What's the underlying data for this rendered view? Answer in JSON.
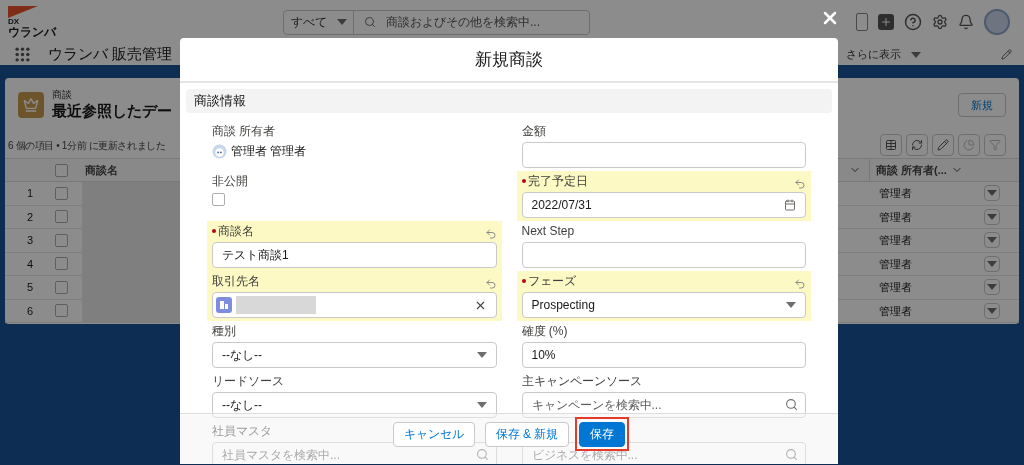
{
  "logo": {
    "line_1": "DX",
    "line_2": "ウランバ"
  },
  "header": {
    "scope": "すべて",
    "search_placeholder": "商談およびその他を検索中..."
  },
  "app_name": "ウランバ 販売管理",
  "nav": {
    "more_tab": "さらに表示"
  },
  "list": {
    "object": "商談",
    "title": "最近参照したデー",
    "all_selected": false,
    "status": "6 個の項目 • 1分前 に更新されました",
    "new_button": "新規",
    "columns": [
      {
        "label": "商談名"
      },
      {
        "label": "商談 所有者(..."
      }
    ],
    "rows": [
      {
        "number": "1",
        "owner": "管理者",
        "checked": false
      },
      {
        "number": "2",
        "owner": "管理者",
        "checked": false
      },
      {
        "number": "3",
        "owner": "管理者",
        "checked": false
      },
      {
        "number": "4",
        "owner": "管理者",
        "checked": false
      },
      {
        "number": "5",
        "owner": "管理者",
        "checked": false
      },
      {
        "number": "6",
        "owner": "管理者",
        "checked": false
      }
    ]
  },
  "modal": {
    "title": "新規商談",
    "section": "商談情報",
    "left_fields": [
      {
        "kind": "owner",
        "label": "商談 所有者",
        "value": "管理者 管理者",
        "required": false,
        "changed": false
      },
      {
        "kind": "checkbox",
        "label": "非公開",
        "checked": false,
        "required": false,
        "changed": false
      },
      {
        "kind": "text",
        "label": "商談名",
        "value": "テスト商談1",
        "required": true,
        "changed": true
      },
      {
        "kind": "record",
        "label": "取引先名",
        "required": false,
        "changed": true
      },
      {
        "kind": "select",
        "label": "種別",
        "value": "--なし--",
        "required": false,
        "changed": false
      },
      {
        "kind": "select",
        "label": "リードソース",
        "value": "--なし--",
        "required": false,
        "changed": false
      },
      {
        "kind": "search",
        "label": "社員マスタ",
        "placeholder": "社員マスタを検索中...",
        "required": false,
        "changed": false
      }
    ],
    "right_fields": [
      {
        "kind": "text",
        "label": "金額",
        "required": false,
        "changed": false
      },
      {
        "kind": "date",
        "label": "完了予定日",
        "value": "2022/07/31",
        "required": true,
        "changed": true
      },
      {
        "kind": "text",
        "label": "Next Step",
        "required": false,
        "changed": false
      },
      {
        "kind": "select",
        "label": "フェーズ",
        "value": "Prospecting",
        "required": true,
        "changed": true
      },
      {
        "kind": "text",
        "label": "確度 (%)",
        "value": "10%",
        "required": false,
        "changed": false
      },
      {
        "kind": "search",
        "label": "主キャンペーンソース",
        "placeholder": "キャンペーンを検索中...",
        "required": false,
        "changed": false
      },
      {
        "kind": "search",
        "placeholder": "ビジネスを検索中...",
        "required": false,
        "changed": false
      }
    ],
    "buttons": [
      {
        "label": "キャンセル",
        "kind": "neutral",
        "emphasized": false
      },
      {
        "label": "保存 & 新規",
        "kind": "neutral",
        "emphasized": false
      },
      {
        "label": "保存",
        "kind": "brand",
        "emphasized": true
      }
    ]
  }
}
